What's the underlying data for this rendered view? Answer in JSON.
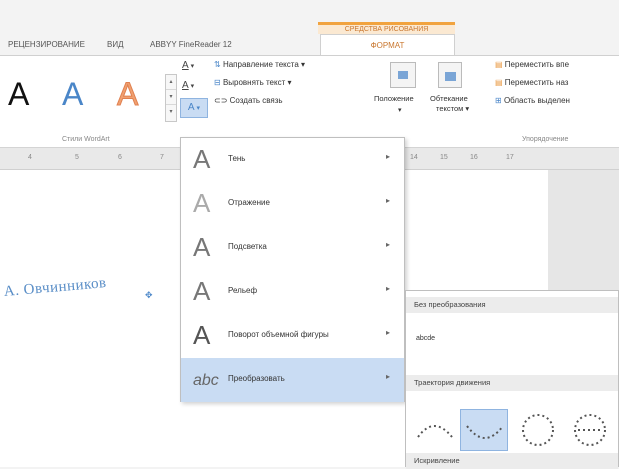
{
  "contextual": {
    "label": "СРЕДСТВА РИСОВАНИЯ"
  },
  "tabs": [
    {
      "label": "РЕЦЕНЗИРОВАНИЕ"
    },
    {
      "label": "ВИД"
    },
    {
      "label": "ABBYY FineReader 12"
    },
    {
      "label": "ФОРМАТ"
    }
  ],
  "ribbon": {
    "wordart_group_label": "Стили WordArt",
    "styles": [
      {
        "glyph": "A"
      },
      {
        "glyph": "A"
      },
      {
        "glyph": "A"
      }
    ],
    "text_group": {
      "direction": "Направление текста",
      "align": "Выровнять текст",
      "link": "Создать связь"
    },
    "position": "Положение",
    "wrap_line1": "Обтекание",
    "wrap_line2": "текстом",
    "bring_forward": "Переместить впе",
    "send_backward": "Переместить наз",
    "selection_pane": "Область выделен",
    "arrange_group_label": "Упорядочение"
  },
  "ruler": {
    "marks": [
      "4",
      "5",
      "6",
      "7",
      "14",
      "15",
      "16",
      "17"
    ]
  },
  "document": {
    "wordart_text": "А. Овчинников"
  },
  "menu": {
    "items": [
      {
        "label": "Тень",
        "icon": "A"
      },
      {
        "label": "Отражение",
        "icon": "A"
      },
      {
        "label": "Подсветка",
        "icon": "A"
      },
      {
        "label": "Рельеф",
        "icon": "A"
      },
      {
        "label": "Поворот объемной фигуры",
        "icon": "A"
      },
      {
        "label": "Преобразовать",
        "icon": "abc"
      }
    ]
  },
  "submenu": {
    "no_transform_header": "Без преобразования",
    "no_transform_sample": "abcde",
    "path_header": "Траектория движения",
    "warp_header": "Искривление"
  },
  "colors": {
    "accent": "#f1a33f",
    "wordart_blue": "#4a86c8",
    "wordart_orange": "#f0a070",
    "selection": "#c9dcf3"
  }
}
